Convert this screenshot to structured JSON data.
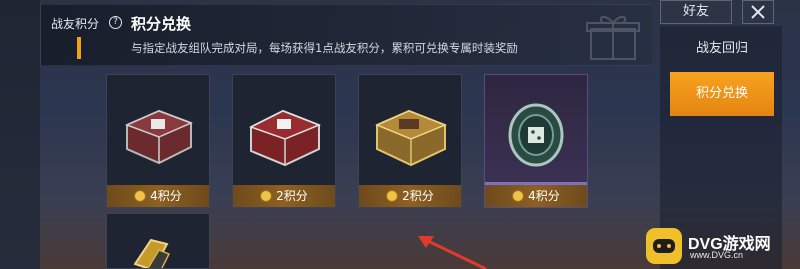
{
  "header": {
    "points_label": "战友积分",
    "help_glyph": "?",
    "title": "积分兑换",
    "description": "与指定战友组队完成对局，每场获得1点战友积分，累积可兑换专属时装奖励"
  },
  "right_nav": {
    "friends_tab": "好友",
    "close_glyph": "✕",
    "items": [
      {
        "label": "战友回归",
        "active": false
      },
      {
        "label": "积分兑换",
        "active": true
      }
    ],
    "active_color": "#f39a1c"
  },
  "cards": [
    {
      "price": "4积分",
      "item_icon": "silver-crate-icon"
    },
    {
      "price": "2积分",
      "item_icon": "red-crate-icon"
    },
    {
      "price": "2积分",
      "item_icon": "gold-crate-icon"
    },
    {
      "price": "4积分",
      "item_icon": "emblem-medal-icon"
    }
  ],
  "watermark": {
    "brand": "DVG游戏网",
    "url": "www.DVG.cn"
  }
}
